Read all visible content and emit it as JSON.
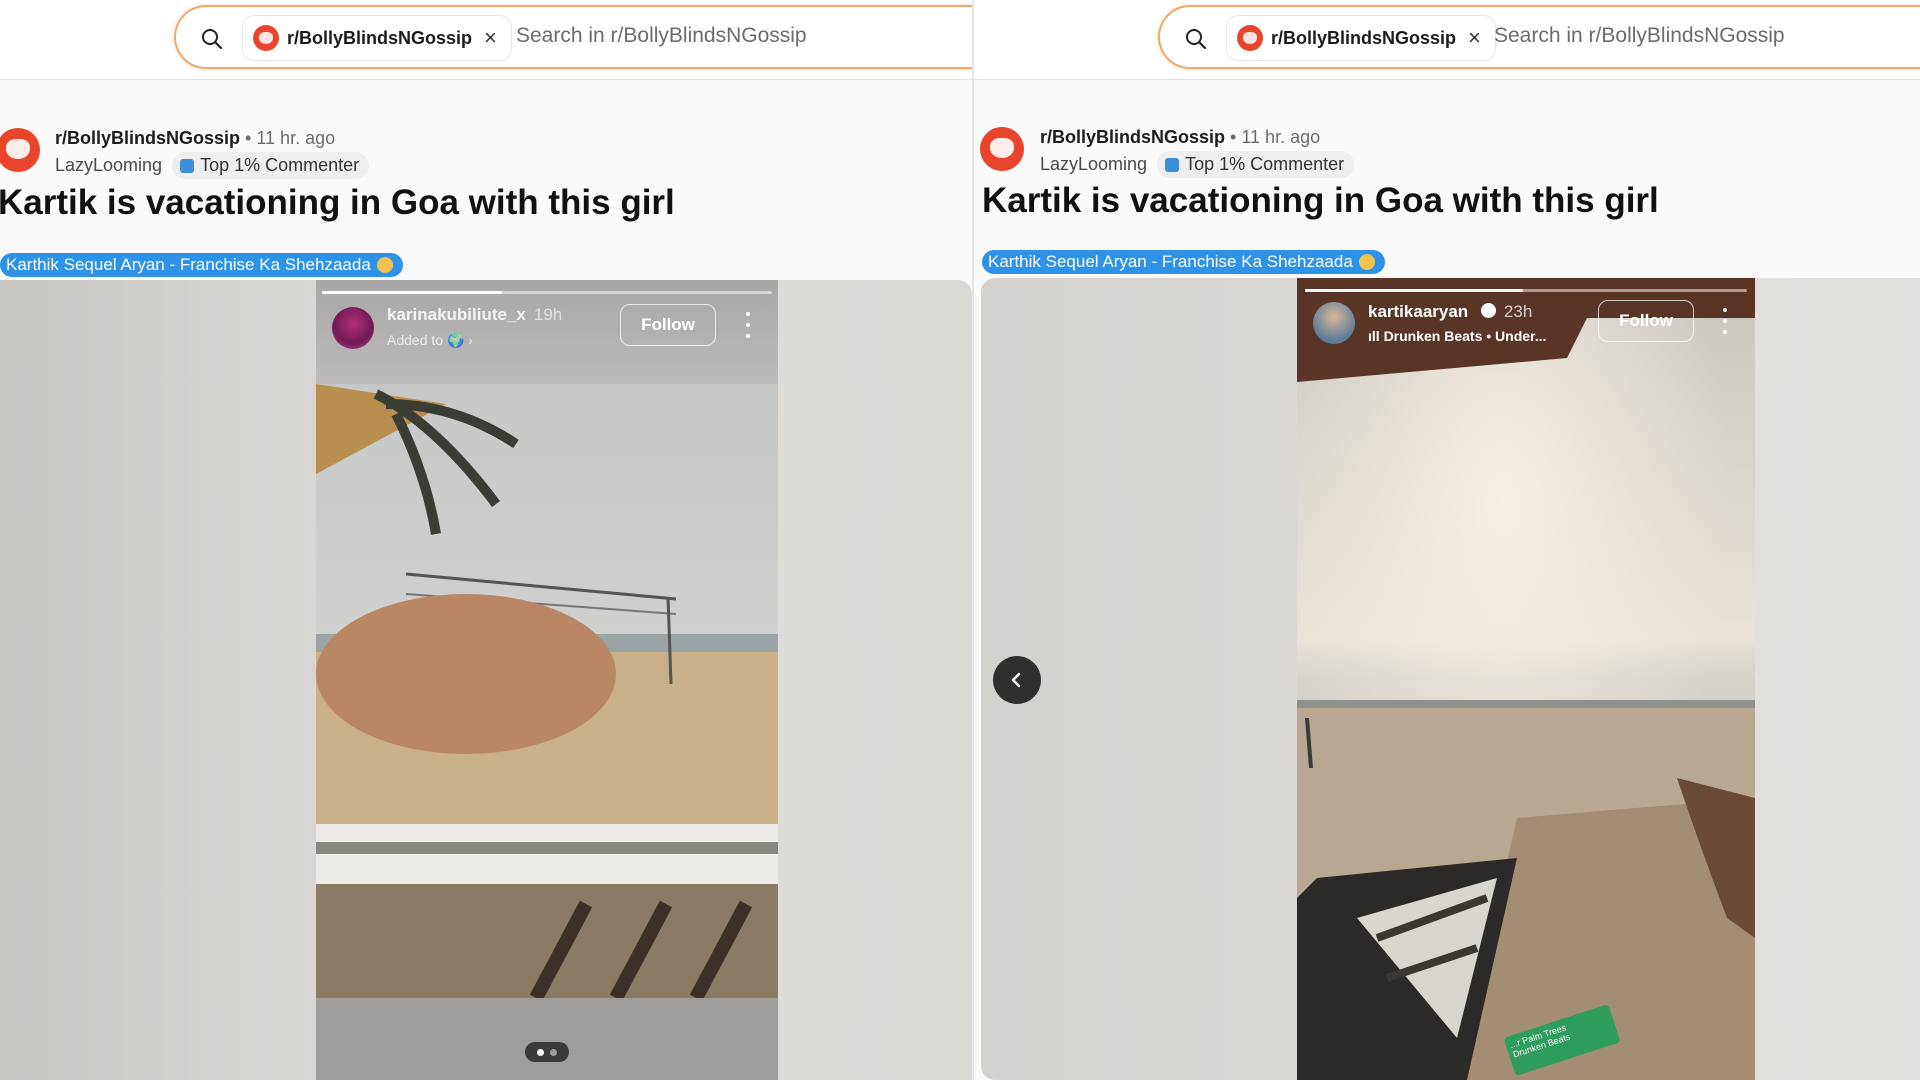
{
  "panels": [
    {
      "search": {
        "chip_label": "r/BollyBlindsNGossip",
        "placeholder": "Search in r/BollyBlindsNGossip"
      },
      "post": {
        "subreddit": "r/BollyBlindsNGossip",
        "separator": "•",
        "time": "11 hr. ago",
        "author": "LazyLooming",
        "badge": "Top 1% Commenter",
        "title": "Kartik is vacationing in Goa with this girl",
        "flair": "Karthik Sequel Aryan - Franchise Ka Shehzaada"
      },
      "story": {
        "username": "karinakubiliute_x",
        "age": "19h",
        "subtitle": "Added to",
        "follow_label": "Follow",
        "carousel_index": 1,
        "carousel_total": 2
      }
    },
    {
      "search": {
        "chip_label": "r/BollyBlindsNGossip",
        "placeholder": "Search in r/BollyBlindsNGossip"
      },
      "post": {
        "subreddit": "r/BollyBlindsNGossip",
        "separator": "•",
        "time": "11 hr. ago",
        "author": "LazyLooming",
        "badge": "Top 1% Commenter",
        "title": "Kartik is vacationing in Goa with this girl",
        "flair": "Karthik Sequel Aryan - Franchise Ka Shehzaada"
      },
      "story": {
        "username": "kartikaaryan",
        "age": "23h",
        "subtitle": "Drunken Beats • Under...",
        "follow_label": "Follow",
        "sticker_text": "...r Palm Trees\nDrunken Beats",
        "carousel_index": 1,
        "carousel_total": 2
      }
    }
  ],
  "colors": {
    "accent_search_border": "#f2a66a",
    "subreddit_avatar": "#e8452c",
    "flair_bg": "#2e93e8",
    "nav_button": "#2f2f2f"
  },
  "icons": {
    "search": "search-icon",
    "close": "close-icon",
    "prev": "chevron-left-icon",
    "more": "kebab-menu-icon",
    "verified": "verified-badge-icon",
    "music": "music-bars-icon"
  }
}
